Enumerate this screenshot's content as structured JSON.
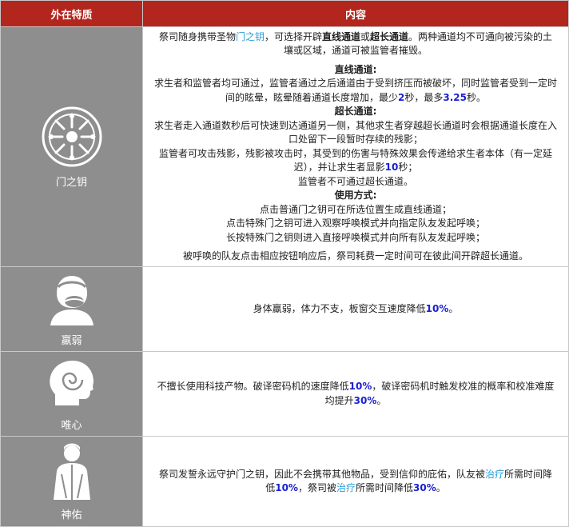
{
  "header": {
    "col1": "外在特质",
    "col2": "内容"
  },
  "rows": [
    {
      "label": "门之钥",
      "icon": "ornate-key-medallion-icon",
      "intro": {
        "a": "祭司随身携带圣物",
        "link": "门之钥",
        "b": "，可选择开辟",
        "bold1": "直线通道",
        "c": "或",
        "bold2": "超长通道",
        "d": "。两种通道均不可通向被污染的土壤或区域，通道可被监管者摧毁。"
      },
      "straight_title": "直线通道:",
      "straight_a": "求生者和监管者均可通过，监管者通过之后通道由于受到挤压而被破坏，同时监管者受到一定时间的眩晕，眩晕随着通道长度增加，最少",
      "straight_num1": "2",
      "straight_b": "秒，最多",
      "straight_num2": "3.25",
      "straight_c": "秒。",
      "long_title": "超长通道:",
      "long_1": "求生者走入通道数秒后可快速到达通道另一侧，其他求生者穿越超长通道时会根据通道长度在入口处留下一段暂时存续的残影；",
      "long_2a": "监管者可攻击残影，残影被攻击时，其受到的伤害与特殊效果会传递给求生者本体（有一定延迟），并让求生者显影",
      "long_2num": "10",
      "long_2b": "秒；",
      "long_3": "监管者不可通过超长通道。",
      "usage_title": "使用方式:",
      "usage": [
        "点击普通门之钥可在所选位置生成直线通道；",
        "点击特殊门之钥可进入观察呼唤模式并向指定队友发起呼唤；",
        "长按特殊门之钥则进入直接呼唤模式并向所有队友发起呼唤；"
      ],
      "final": "被呼唤的队友点击相应按钮响应后，祭司耗费一定时间可在彼此间开辟超长通道。"
    },
    {
      "label": "羸弱",
      "icon": "coughing-person-icon",
      "a": "身体羸弱，体力不支，板窗交互速度降低",
      "num": "10%",
      "b": "。"
    },
    {
      "label": "唯心",
      "icon": "head-spiral-icon",
      "a": "不擅长使用科技产物。破译密码机的速度降低",
      "num1": "10%",
      "b": "，破译密码机时触发校准的概率和校准难度均提升",
      "num2": "30%",
      "c": "。"
    },
    {
      "label": "神佑",
      "icon": "robed-figure-icon",
      "a": "祭司发誓永远守护门之钥，因此不会携带其他物品，受到信仰的庇佑，队友被",
      "link1": "治疗",
      "b": "所需时间降低",
      "num1": "10%",
      "c": "，祭司被",
      "link2": "治疗",
      "d": "所需时间降低",
      "num2": "30%",
      "e": "。"
    }
  ]
}
